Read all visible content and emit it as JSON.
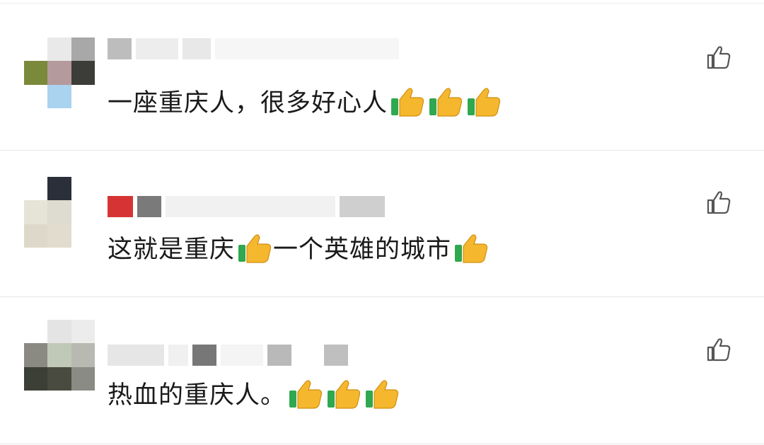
{
  "comments": [
    {
      "text_before": "一座重庆人，很多好心人",
      "thumbs_after_before": 3,
      "text_after": "",
      "thumbs_end": 0
    },
    {
      "text_before": "这就是重庆",
      "thumbs_after_before": 1,
      "text_after": "一个英雄的城市",
      "thumbs_end": 1
    },
    {
      "text_before": "热血的重庆人。",
      "thumbs_after_before": 3,
      "text_after": "",
      "thumbs_end": 0
    }
  ],
  "icons": {
    "like": "thumbs-up-outline-icon",
    "emoji": "thumbs-up-emoji-icon"
  },
  "colors": {
    "text": "#1a1a1a",
    "icon": "#555555",
    "emoji_yellow": "#f5b72e",
    "emoji_green": "#2fa84f"
  }
}
